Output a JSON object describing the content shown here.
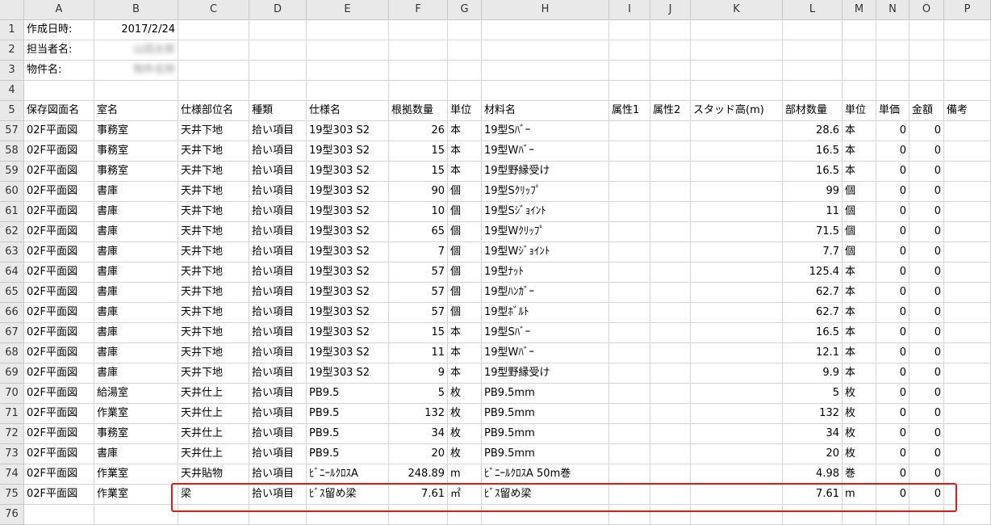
{
  "columns": [
    "A",
    "B",
    "C",
    "D",
    "E",
    "F",
    "G",
    "H",
    "I",
    "J",
    "K",
    "L",
    "M",
    "N",
    "O",
    "P"
  ],
  "meta": [
    {
      "row": "1",
      "label": "作成日時:",
      "value": "2017/2/24",
      "blur": false
    },
    {
      "row": "2",
      "label": "担当者名:",
      "value": "山田太郎",
      "blur": true
    },
    {
      "row": "3",
      "label": "物件名:",
      "value": "物件名称",
      "blur": true
    }
  ],
  "empty_row": "4",
  "header_row": {
    "row": "5",
    "cells": [
      "保存図面名",
      "室名",
      "仕様部位名",
      "種類",
      "仕様名",
      "根拠数量",
      "単位",
      "材料名",
      "属性1",
      "属性2",
      "スタッド高(m)",
      "部材数量",
      "単位",
      "単価",
      "金額",
      "備考"
    ]
  },
  "rows": [
    {
      "row": "57",
      "cells": [
        "02F平面図",
        "事務室",
        "天井下地",
        "拾い項目",
        "19型303 S2",
        "26",
        "本",
        "19型Sﾊﾞｰ",
        "",
        "",
        "",
        "28.6",
        "本",
        "0",
        "0",
        ""
      ]
    },
    {
      "row": "58",
      "cells": [
        "02F平面図",
        "事務室",
        "天井下地",
        "拾い項目",
        "19型303 S2",
        "15",
        "本",
        "19型Wﾊﾞｰ",
        "",
        "",
        "",
        "16.5",
        "本",
        "0",
        "0",
        ""
      ]
    },
    {
      "row": "59",
      "cells": [
        "02F平面図",
        "事務室",
        "天井下地",
        "拾い項目",
        "19型303 S2",
        "15",
        "本",
        "19型野縁受け",
        "",
        "",
        "",
        "16.5",
        "本",
        "0",
        "0",
        ""
      ]
    },
    {
      "row": "60",
      "cells": [
        "02F平面図",
        "書庫",
        "天井下地",
        "拾い項目",
        "19型303 S2",
        "90",
        "個",
        "19型Sｸﾘｯﾌﾟ",
        "",
        "",
        "",
        "99",
        "個",
        "0",
        "0",
        ""
      ]
    },
    {
      "row": "61",
      "cells": [
        "02F平面図",
        "書庫",
        "天井下地",
        "拾い項目",
        "19型303 S2",
        "10",
        "個",
        "19型Sｼﾞｮｲﾝﾄ",
        "",
        "",
        "",
        "11",
        "個",
        "0",
        "0",
        ""
      ]
    },
    {
      "row": "62",
      "cells": [
        "02F平面図",
        "書庫",
        "天井下地",
        "拾い項目",
        "19型303 S2",
        "65",
        "個",
        "19型Wｸﾘｯﾌﾟ",
        "",
        "",
        "",
        "71.5",
        "個",
        "0",
        "0",
        ""
      ]
    },
    {
      "row": "63",
      "cells": [
        "02F平面図",
        "書庫",
        "天井下地",
        "拾い項目",
        "19型303 S2",
        "7",
        "個",
        "19型Wｼﾞｮｲﾝﾄ",
        "",
        "",
        "",
        "7.7",
        "個",
        "0",
        "0",
        ""
      ]
    },
    {
      "row": "64",
      "cells": [
        "02F平面図",
        "書庫",
        "天井下地",
        "拾い項目",
        "19型303 S2",
        "57",
        "個",
        "19型ﾅｯﾄ",
        "",
        "",
        "",
        "125.4",
        "本",
        "0",
        "0",
        ""
      ]
    },
    {
      "row": "65",
      "cells": [
        "02F平面図",
        "書庫",
        "天井下地",
        "拾い項目",
        "19型303 S2",
        "57",
        "個",
        "19型ﾊﾝｶﾞｰ",
        "",
        "",
        "",
        "62.7",
        "本",
        "0",
        "0",
        ""
      ]
    },
    {
      "row": "66",
      "cells": [
        "02F平面図",
        "書庫",
        "天井下地",
        "拾い項目",
        "19型303 S2",
        "57",
        "個",
        "19型ﾎﾞﾙﾄ",
        "",
        "",
        "",
        "62.7",
        "本",
        "0",
        "0",
        ""
      ]
    },
    {
      "row": "67",
      "cells": [
        "02F平面図",
        "書庫",
        "天井下地",
        "拾い項目",
        "19型303 S2",
        "15",
        "本",
        "19型Sﾊﾞｰ",
        "",
        "",
        "",
        "16.5",
        "本",
        "0",
        "0",
        ""
      ]
    },
    {
      "row": "68",
      "cells": [
        "02F平面図",
        "書庫",
        "天井下地",
        "拾い項目",
        "19型303 S2",
        "11",
        "本",
        "19型Wﾊﾞｰ",
        "",
        "",
        "",
        "12.1",
        "本",
        "0",
        "0",
        ""
      ]
    },
    {
      "row": "69",
      "cells": [
        "02F平面図",
        "書庫",
        "天井下地",
        "拾い項目",
        "19型303 S2",
        "9",
        "本",
        "19型野縁受け",
        "",
        "",
        "",
        "9.9",
        "本",
        "0",
        "0",
        ""
      ]
    },
    {
      "row": "70",
      "cells": [
        "02F平面図",
        "給湯室",
        "天井仕上",
        "拾い項目",
        "PB9.5",
        "5",
        "枚",
        "PB9.5mm",
        "",
        "",
        "",
        "5",
        "枚",
        "0",
        "0",
        ""
      ]
    },
    {
      "row": "71",
      "cells": [
        "02F平面図",
        "作業室",
        "天井仕上",
        "拾い項目",
        "PB9.5",
        "132",
        "枚",
        "PB9.5mm",
        "",
        "",
        "",
        "132",
        "枚",
        "0",
        "0",
        ""
      ]
    },
    {
      "row": "72",
      "cells": [
        "02F平面図",
        "事務室",
        "天井仕上",
        "拾い項目",
        "PB9.5",
        "34",
        "枚",
        "PB9.5mm",
        "",
        "",
        "",
        "34",
        "枚",
        "0",
        "0",
        ""
      ]
    },
    {
      "row": "73",
      "cells": [
        "02F平面図",
        "書庫",
        "天井仕上",
        "拾い項目",
        "PB9.5",
        "20",
        "枚",
        "PB9.5mm",
        "",
        "",
        "",
        "20",
        "枚",
        "0",
        "0",
        ""
      ]
    },
    {
      "row": "74",
      "cells": [
        "02F平面図",
        "作業室",
        "天井貼物",
        "拾い項目",
        "ﾋﾞﾆｰﾙｸﾛｽA",
        "248.89",
        "m",
        "ﾋﾞﾆｰﾙｸﾛｽA 50m巻",
        "",
        "",
        "",
        "4.98",
        "巻",
        "0",
        "0",
        ""
      ]
    },
    {
      "row": "75",
      "cells": [
        "02F平面図",
        "作業室",
        "梁",
        "拾い項目",
        "ﾋﾞｽ留め梁",
        "7.61",
        "㎡",
        "ﾋﾞｽ留め梁",
        "",
        "",
        "",
        "7.61",
        "m",
        "0",
        "0",
        ""
      ]
    }
  ],
  "last_row": "76",
  "highlight_row": "75",
  "colors": {
    "highlight": "#e01818",
    "header_bg": "#e9e9e9",
    "grid": "#d4d4d4"
  }
}
